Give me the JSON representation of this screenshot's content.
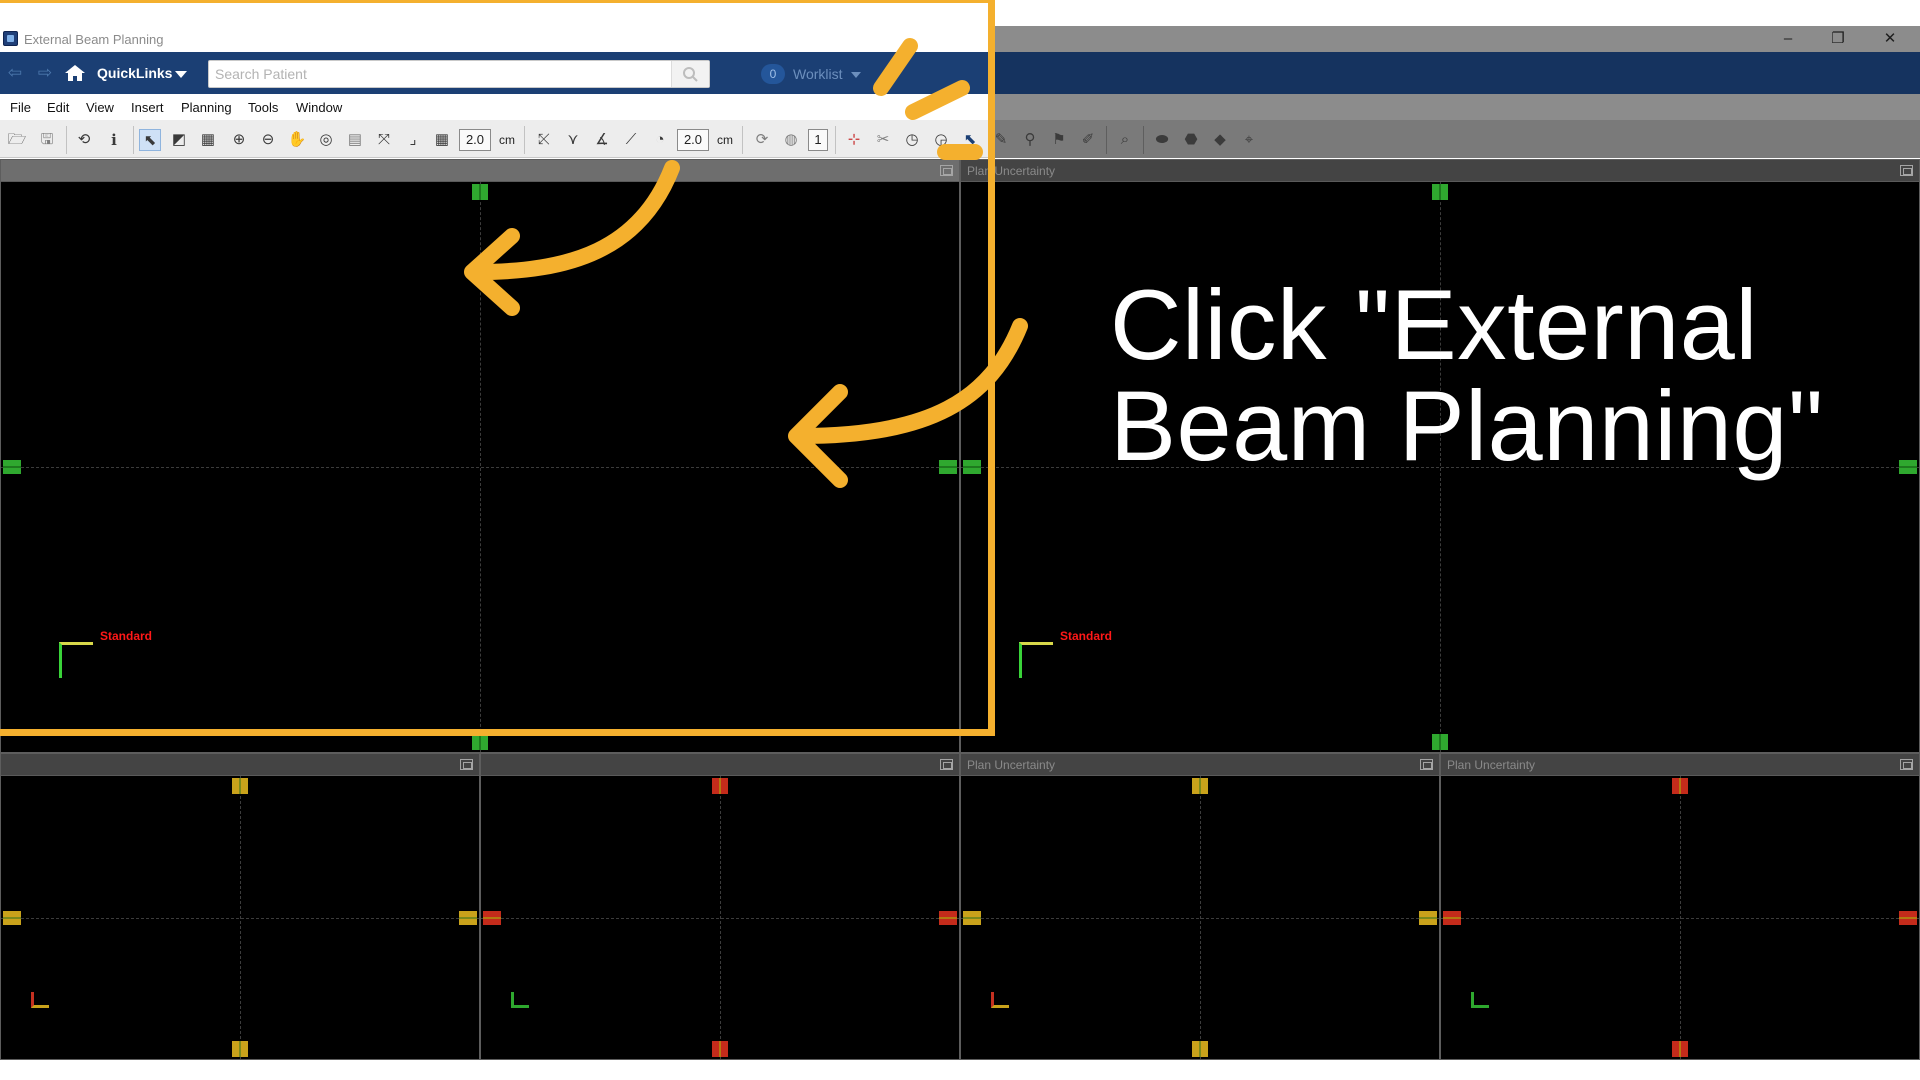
{
  "window": {
    "title": "External Beam Planning",
    "controls": [
      "–",
      "❐",
      "✕"
    ]
  },
  "navbar": {
    "quicklinks_label": "QuickLinks",
    "search_placeholder": "Search Patient",
    "worklist_count": "0",
    "worklist_label": "Worklist"
  },
  "menu": [
    "File",
    "Edit",
    "View",
    "Insert",
    "Planning",
    "Tools",
    "Window"
  ],
  "toolbar": {
    "zoom_value_1": "2.0",
    "zoom_unit_1": "cm",
    "zoom_value_2": "2.0",
    "zoom_unit_2": "cm",
    "layer_value": "1"
  },
  "viewports": {
    "top_left_title": "",
    "top_right_title": "Plan Uncertainty",
    "bottom_1_title": "",
    "bottom_2_title": "",
    "bottom_3_title": "Plan Uncertainty",
    "bottom_4_title": "Plan Uncertainty",
    "standard_label": "Standard"
  },
  "overlay": {
    "instruction": "Click \"External\nBeam Planning\"",
    "accent_color": "#f4b02e"
  },
  "colors": {
    "nav_blue": "#1b3f74",
    "marker_green": "#2fa82f",
    "marker_yellow": "#c9a21b",
    "marker_red": "#c42b1b",
    "standard_red": "#ff1818"
  }
}
